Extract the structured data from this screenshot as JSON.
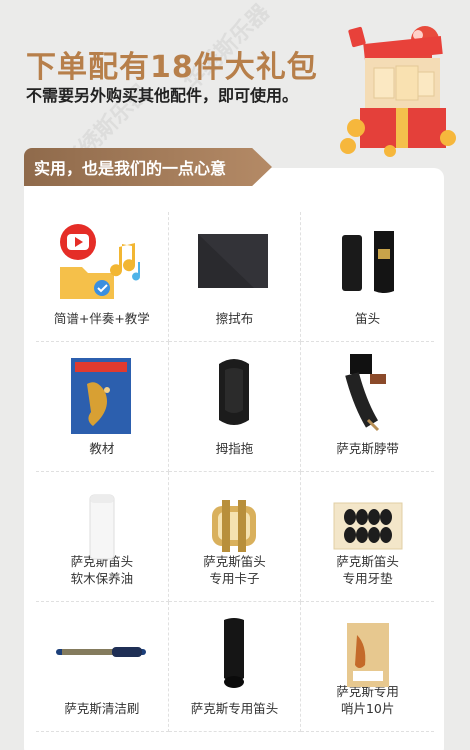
{
  "hero": {
    "title": "下单配有18件大礼包",
    "subtitle": "不需要另外购买其他配件，即可使用。"
  },
  "section": {
    "tab_label": "实用，也是我们的一点心意"
  },
  "watermark": "华绣斯乐器",
  "items": [
    {
      "label": "简谱+伴奏+教学",
      "label2": ""
    },
    {
      "label": "擦拭布",
      "label2": ""
    },
    {
      "label": "笛头",
      "label2": ""
    },
    {
      "label": "教材",
      "label2": ""
    },
    {
      "label": "拇指拖",
      "label2": ""
    },
    {
      "label": "萨克斯脖带",
      "label2": ""
    },
    {
      "label": "萨克斯笛头",
      "label2": "软木保养油"
    },
    {
      "label": "萨克斯笛头",
      "label2": "专用卡子"
    },
    {
      "label": "萨克斯笛头",
      "label2": "专用牙垫"
    },
    {
      "label": "萨克斯清洁刷",
      "label2": ""
    },
    {
      "label": "萨克斯专用笛头",
      "label2": ""
    },
    {
      "label": "萨克斯专用",
      "label2": "哨片10片"
    }
  ],
  "colors": {
    "accent": "#b77f4a",
    "tab": "#9b7354"
  }
}
